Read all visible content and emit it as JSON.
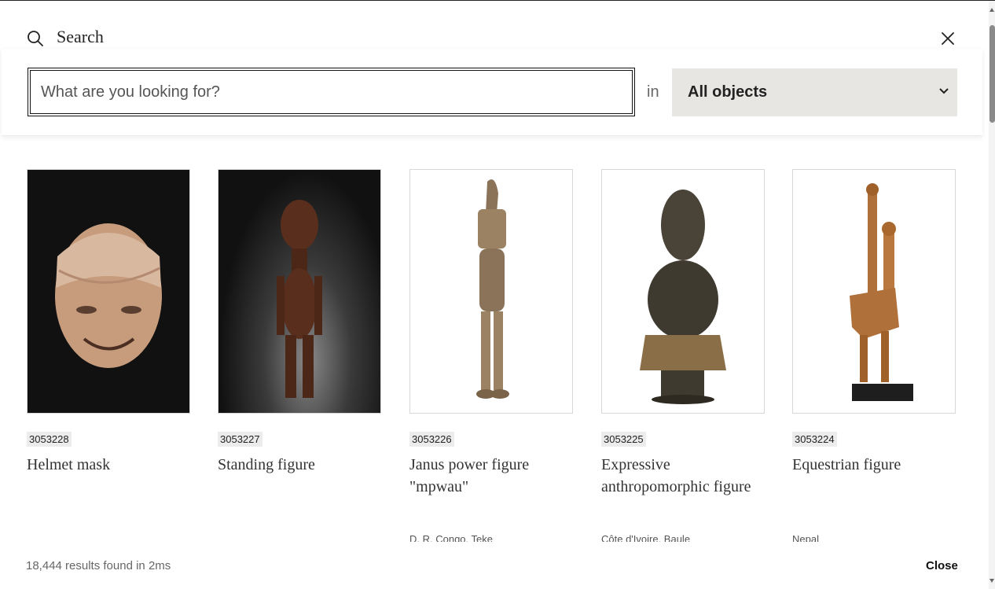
{
  "header": {
    "title": "Search"
  },
  "search": {
    "placeholder": "What are you looking for?",
    "in_label": "in",
    "scope_selected": "All objects"
  },
  "results": [
    {
      "id": "3053228",
      "name": "Helmet mask",
      "origin": ""
    },
    {
      "id": "3053227",
      "name": "Standing figure",
      "origin": ""
    },
    {
      "id": "3053226",
      "name": "Janus power figure \"mpwau\"",
      "origin": "D. R. Congo, Teke"
    },
    {
      "id": "3053225",
      "name": "Expressive anthropomorphic figure",
      "origin": "Côte d'Ivoire, Baule"
    },
    {
      "id": "3053224",
      "name": "Equestrian figure",
      "origin": "Nepal"
    }
  ],
  "footer": {
    "results_count": "18,444 results found in 2ms",
    "close_label": "Close"
  }
}
